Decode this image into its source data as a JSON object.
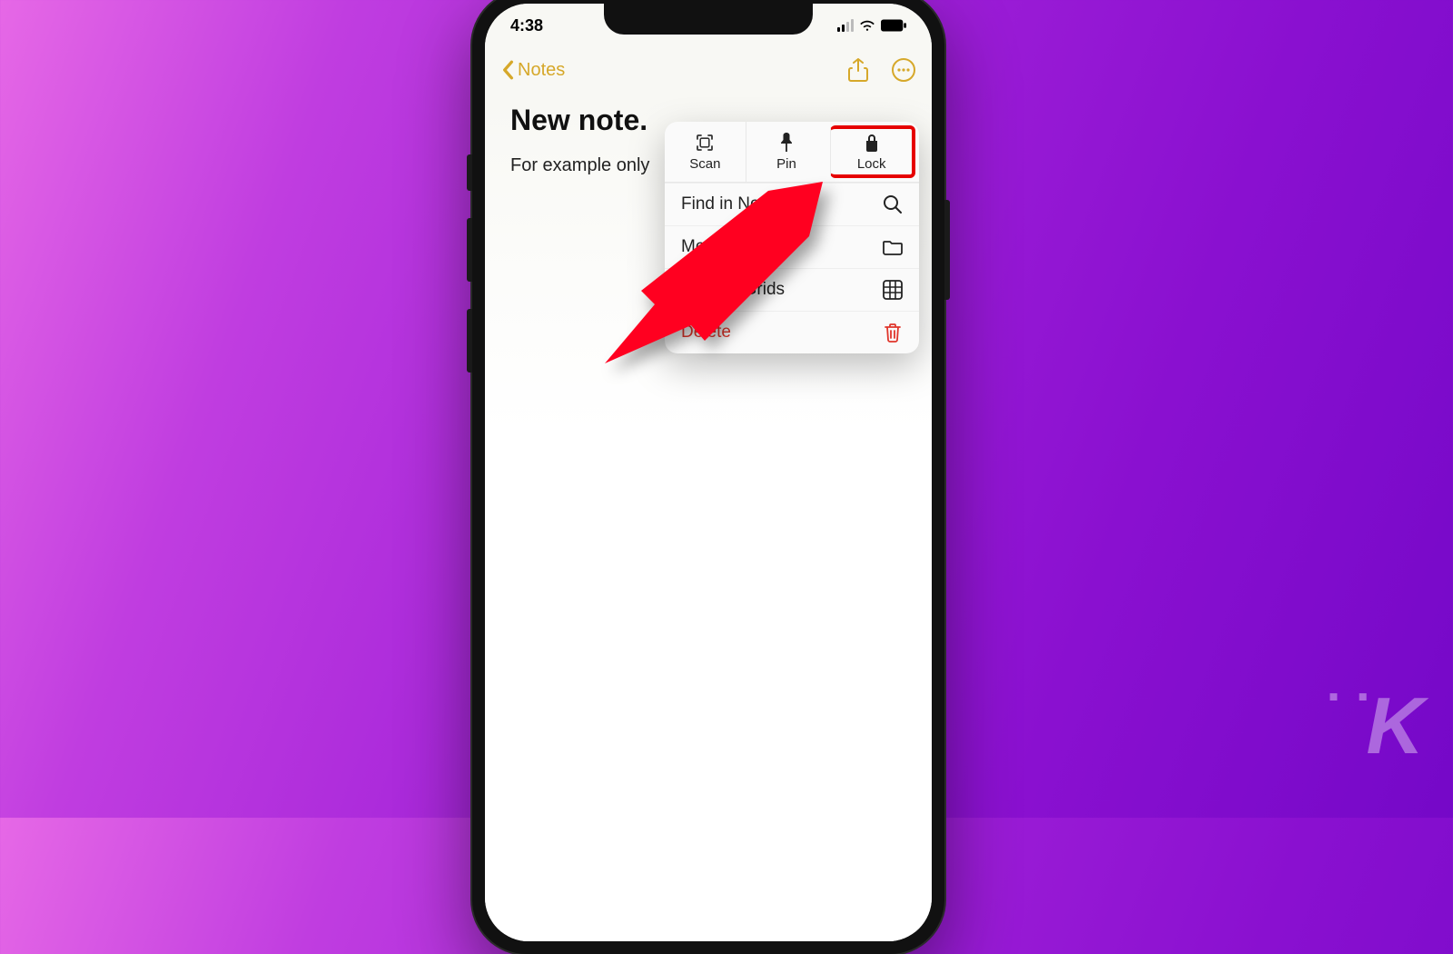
{
  "status": {
    "time": "4:38"
  },
  "nav": {
    "back_label": "Notes"
  },
  "note": {
    "title": "New note.",
    "body": "For example only"
  },
  "popover": {
    "top_actions": {
      "scan": "Scan",
      "pin": "Pin",
      "lock": "Lock"
    },
    "rows": {
      "find": "Find in Note",
      "move": "Move Note",
      "lines": "Lines & Grids",
      "delete": "Delete"
    }
  },
  "watermark": {
    "letter": "K"
  }
}
